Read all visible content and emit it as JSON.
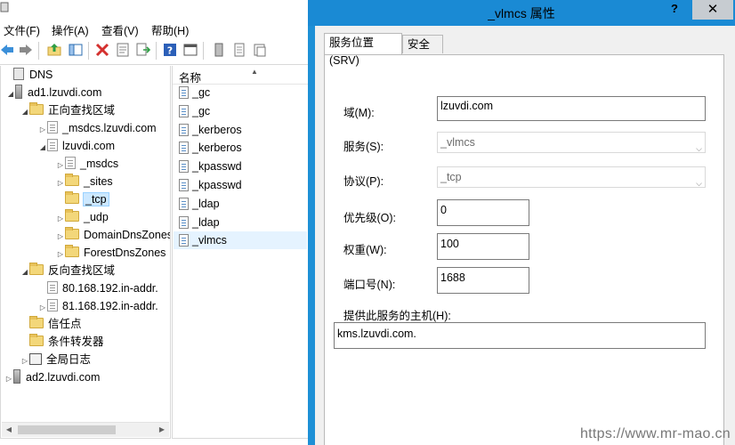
{
  "menu": [
    "文件(F)",
    "操作(A)",
    "查看(V)",
    "帮助(H)"
  ],
  "tree": [
    {
      "label": "DNS",
      "icon": "dns-root-icon",
      "expander": ""
    },
    {
      "label": "ad1.lzuvdi.com",
      "icon": "server-icon",
      "expander": "◢"
    },
    {
      "label": "正向查找区域",
      "icon": "folder-icon",
      "expander": "◢"
    },
    {
      "label": "_msdcs.lzuvdi.com",
      "icon": "zone-icon",
      "expander": "▷"
    },
    {
      "label": "lzuvdi.com",
      "icon": "zone-icon",
      "expander": "◢"
    },
    {
      "label": "_msdcs",
      "icon": "zone-icon",
      "expander": "▷"
    },
    {
      "label": "_sites",
      "icon": "folder-icon",
      "expander": "▷"
    },
    {
      "label": "_tcp",
      "icon": "folder-icon",
      "expander": "",
      "selected": true
    },
    {
      "label": "_udp",
      "icon": "folder-icon",
      "expander": "▷"
    },
    {
      "label": "DomainDnsZones",
      "icon": "folder-icon",
      "expander": "▷"
    },
    {
      "label": "ForestDnsZones",
      "icon": "folder-icon",
      "expander": "▷"
    },
    {
      "label": "反向查找区域",
      "icon": "folder-icon",
      "expander": "◢"
    },
    {
      "label": "80.168.192.in-addr.",
      "icon": "zone-icon",
      "expander": ""
    },
    {
      "label": "81.168.192.in-addr.",
      "icon": "zone-icon",
      "expander": "▷"
    },
    {
      "label": "信任点",
      "icon": "folder-icon",
      "expander": ""
    },
    {
      "label": "条件转发器",
      "icon": "folder-icon",
      "expander": ""
    },
    {
      "label": "全局日志",
      "icon": "log-icon",
      "expander": "▷"
    },
    {
      "label": "ad2.lzuvdi.com",
      "icon": "server-icon",
      "expander": "▷"
    }
  ],
  "list": {
    "header": "名称",
    "records": [
      "_gc",
      "_gc",
      "_kerberos",
      "_kerberos",
      "_kpasswd",
      "_kpasswd",
      "_ldap",
      "_ldap",
      "_vlmcs"
    ]
  },
  "dialog": {
    "title": "_vlmcs 属性",
    "help": "?",
    "close": "✕",
    "tabs": [
      "服务位置(SRV)",
      "安全"
    ],
    "domain_label": "域(M):",
    "domain_value": "lzuvdi.com",
    "service_label": "服务(S):",
    "service_value": "_vlmcs",
    "protocol_label": "协议(P):",
    "protocol_value": "_tcp",
    "priority_label": "优先级(O):",
    "priority_value": "0",
    "weight_label": "权重(W):",
    "weight_value": "100",
    "port_label": "端口号(N):",
    "port_value": "1688",
    "host_label": "提供此服务的主机(H):",
    "host_value": "kms.lzuvdi.com."
  },
  "watermark": "https://www.mr-mao.cn",
  "colors": {
    "dialog_frame": "#1e90d6",
    "selection": "#cce8ff",
    "folder": "#f3d77a"
  }
}
